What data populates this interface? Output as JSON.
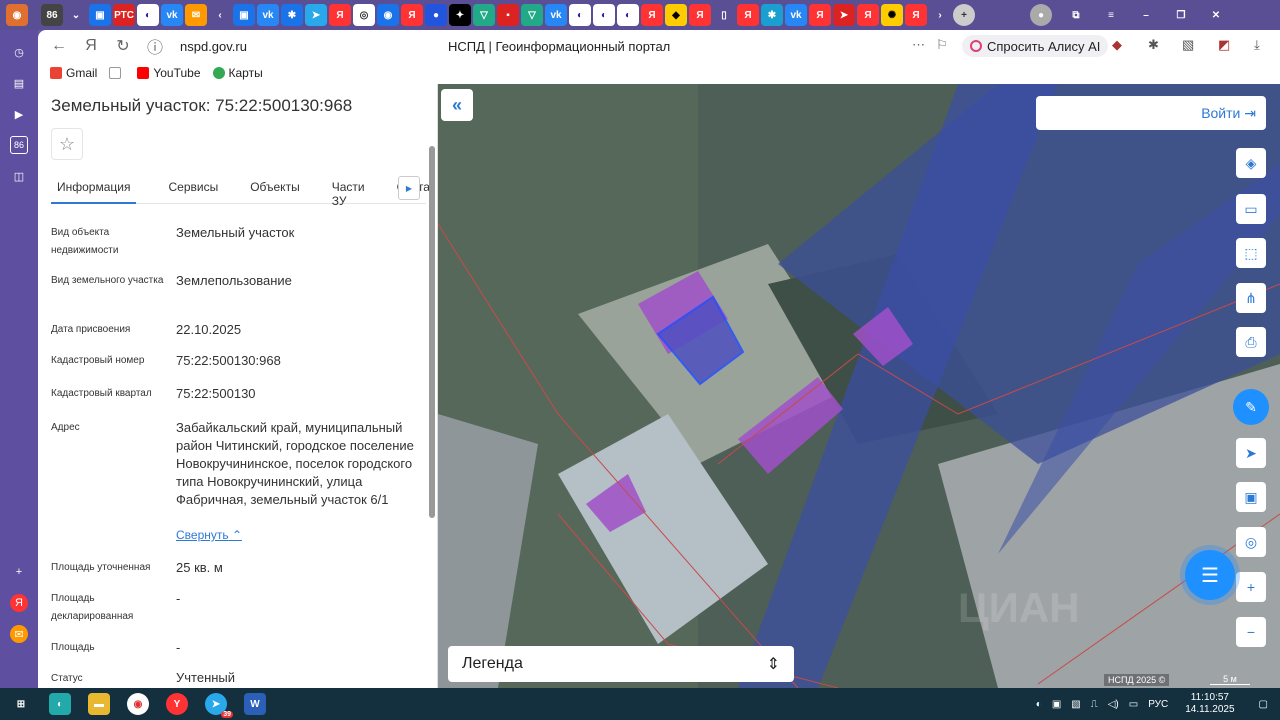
{
  "tabbar": {
    "counter": "86",
    "badge": "РТС"
  },
  "sidestrip": {
    "counter": "86"
  },
  "browser": {
    "url": "nspd.gov.ru",
    "page_title": "НСПД | Геоинформационный портал",
    "alice": "Спросить Алису AI"
  },
  "bookmarks": [
    {
      "label": "Gmail",
      "color": "#ea4335"
    },
    {
      "label": "",
      "color": "#ccc"
    },
    {
      "label": "YouTube",
      "color": "#ff0000"
    },
    {
      "label": "Карты",
      "color": "#34a853"
    }
  ],
  "panel": {
    "title": "Земельный участок: 75:22:500130:968",
    "tabs": [
      "Информация",
      "Сервисы",
      "Объекты",
      "Части ЗУ",
      "Соста"
    ],
    "fields": [
      {
        "label": "Вид объекта недвижимости",
        "value": "Земельный участок"
      },
      {
        "label": "Вид земельного участка",
        "value": "Землепользование"
      },
      {
        "label": "Дата присвоения",
        "value": "22.10.2025"
      },
      {
        "label": "Кадастровый номер",
        "value": "75:22:500130:968"
      },
      {
        "label": "Кадастровый квартал",
        "value": "75:22:500130"
      },
      {
        "label": "Адрес",
        "value": "Забайкальский край, муниципальный район Читинский, городское поселение Новокручининское, поселок городского типа Новокручининский, улица Фабричная, земельный участок 6/1"
      },
      {
        "label": "Площадь уточненная",
        "value": "25 кв. м"
      },
      {
        "label": "Площадь декларированная",
        "value": "-"
      },
      {
        "label": "Площадь",
        "value": "-"
      },
      {
        "label": "Статус",
        "value": "Учтенный"
      }
    ],
    "collapse": "Свернуть"
  },
  "map": {
    "login": "Войти",
    "legend": "Легенда",
    "copyright": "НСПД 2025 ©",
    "scale": "5 м",
    "watermark": "ЦИАН"
  },
  "taskbar": {
    "time": "11:10:57",
    "date": "14.11.2025",
    "lang": "РУС",
    "telegram_badge": "39"
  }
}
